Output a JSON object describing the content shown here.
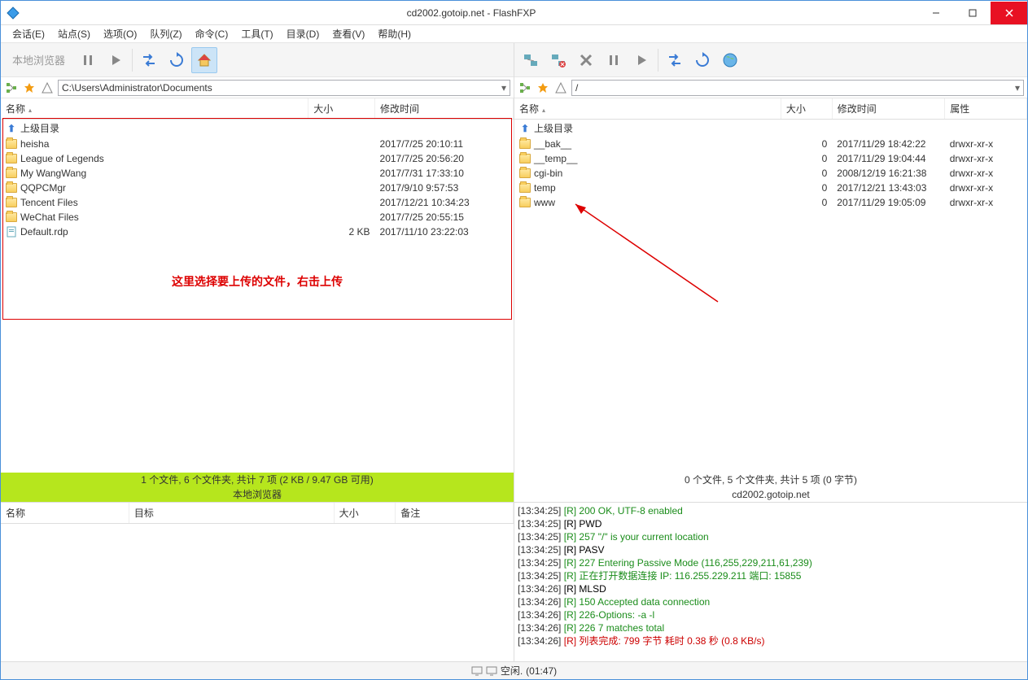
{
  "title": "cd2002.gotoip.net - FlashFXP",
  "menu": [
    "会话(E)",
    "站点(S)",
    "选项(O)",
    "队列(Z)",
    "命令(C)",
    "工具(T)",
    "目录(D)",
    "查看(V)",
    "帮助(H)"
  ],
  "left": {
    "toolbar_label": "本地浏览器",
    "path": "C:\\Users\\Administrator\\Documents",
    "columns": [
      "名称",
      "大小",
      "修改时间"
    ],
    "up_label": "上级目录",
    "rows": [
      {
        "name": "heisha",
        "size": "",
        "date": "2017/7/25 20:10:11",
        "type": "folder"
      },
      {
        "name": "League of Legends",
        "size": "",
        "date": "2017/7/25 20:56:20",
        "type": "folder"
      },
      {
        "name": "My WangWang",
        "size": "",
        "date": "2017/7/31 17:33:10",
        "type": "folder"
      },
      {
        "name": "QQPCMgr",
        "size": "",
        "date": "2017/9/10 9:57:53",
        "type": "folder"
      },
      {
        "name": "Tencent Files",
        "size": "",
        "date": "2017/12/21 10:34:23",
        "type": "folder"
      },
      {
        "name": "WeChat Files",
        "size": "",
        "date": "2017/7/25 20:55:15",
        "type": "folder"
      },
      {
        "name": "Default.rdp",
        "size": "2 KB",
        "date": "2017/11/10 23:22:03",
        "type": "file"
      }
    ],
    "annotation": "这里选择要上传的文件，右击上传",
    "status1": "1 个文件, 6 个文件夹, 共计 7 项 (2 KB / 9.47 GB 可用)",
    "status2": "本地浏览器"
  },
  "right": {
    "path": "/",
    "columns": [
      "名称",
      "大小",
      "修改时间",
      "属性"
    ],
    "up_label": "上级目录",
    "rows": [
      {
        "name": "__bak__",
        "size": "0",
        "date": "2017/11/29 18:42:22",
        "attr": "drwxr-xr-x"
      },
      {
        "name": "__temp__",
        "size": "0",
        "date": "2017/11/29 19:04:44",
        "attr": "drwxr-xr-x"
      },
      {
        "name": "cgi-bin",
        "size": "0",
        "date": "2008/12/19 16:21:38",
        "attr": "drwxr-xr-x"
      },
      {
        "name": "temp",
        "size": "0",
        "date": "2017/12/21 13:43:03",
        "attr": "drwxr-xr-x"
      },
      {
        "name": "www",
        "size": "0",
        "date": "2017/11/29 19:05:09",
        "attr": "drwxr-xr-x"
      }
    ],
    "status1": "0 个文件, 5 个文件夹, 共计 5 项 (0 字节)",
    "status2": "cd2002.gotoip.net"
  },
  "queue_columns": [
    "名称",
    "目标",
    "大小",
    "备注"
  ],
  "log": [
    {
      "t": "[13:34:25]",
      "m": "[R] 200 OK, UTF-8 enabled",
      "c": "green"
    },
    {
      "t": "[13:34:25]",
      "m": "[R] PWD",
      "c": "black"
    },
    {
      "t": "[13:34:25]",
      "m": "[R] 257 \"/\" is your current location",
      "c": "green"
    },
    {
      "t": "[13:34:25]",
      "m": "[R] PASV",
      "c": "black"
    },
    {
      "t": "[13:34:25]",
      "m": "[R] 227 Entering Passive Mode (116,255,229,211,61,239)",
      "c": "green"
    },
    {
      "t": "[13:34:25]",
      "m": "[R] 正在打开数据连接 IP: 116.255.229.211 端口: 15855",
      "c": "green"
    },
    {
      "t": "[13:34:26]",
      "m": "[R] MLSD",
      "c": "black"
    },
    {
      "t": "[13:34:26]",
      "m": "[R] 150 Accepted data connection",
      "c": "green"
    },
    {
      "t": "[13:34:26]",
      "m": "[R] 226-Options: -a -l",
      "c": "green"
    },
    {
      "t": "[13:34:26]",
      "m": "[R] 226 7 matches total",
      "c": "green"
    },
    {
      "t": "[13:34:26]",
      "m": "[R] 列表完成: 799 字节 耗时 0.38 秒 (0.8 KB/s)",
      "c": "red"
    }
  ],
  "statusbar": {
    "state": "空闲.",
    "time": "(01:47)"
  }
}
